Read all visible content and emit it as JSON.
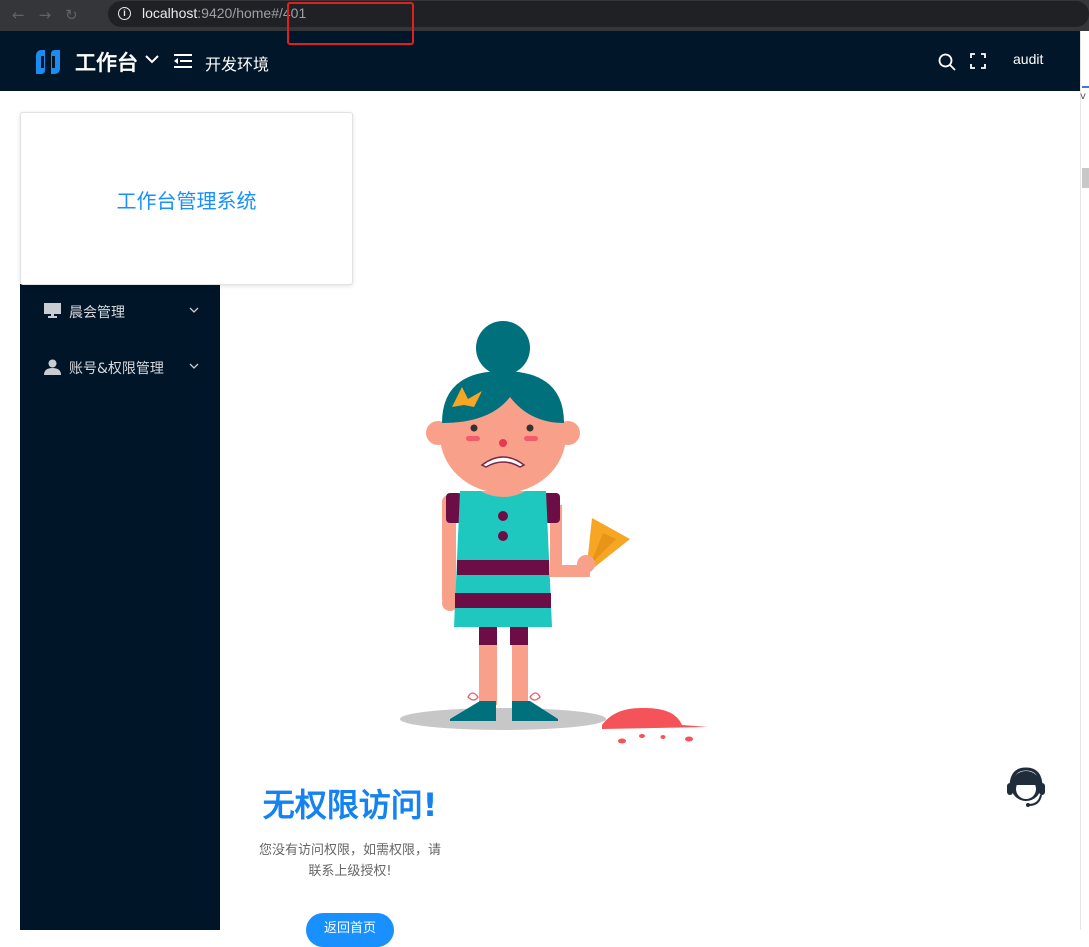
{
  "browser": {
    "url_host": "localhost",
    "url_rest": ":9420/home#/401"
  },
  "header": {
    "workspace_title": "工作台",
    "environment": "开发环境",
    "user": "audit"
  },
  "brand_card": {
    "title": "工作台管理系统"
  },
  "sidebar": {
    "items": [
      {
        "label": "晨会管理",
        "icon": "monitor-icon"
      },
      {
        "label": "账号&权限管理",
        "icon": "user-icon"
      }
    ]
  },
  "error_page": {
    "title": "无权限访问!",
    "description_line1": "您没有访问权限，如需权限，请",
    "description_line2": "联系上级授权!",
    "home_button": "返回首页"
  },
  "colors": {
    "header_bg": "#021629",
    "sidebar_bg": "#001528",
    "accent": "#1890ff"
  }
}
